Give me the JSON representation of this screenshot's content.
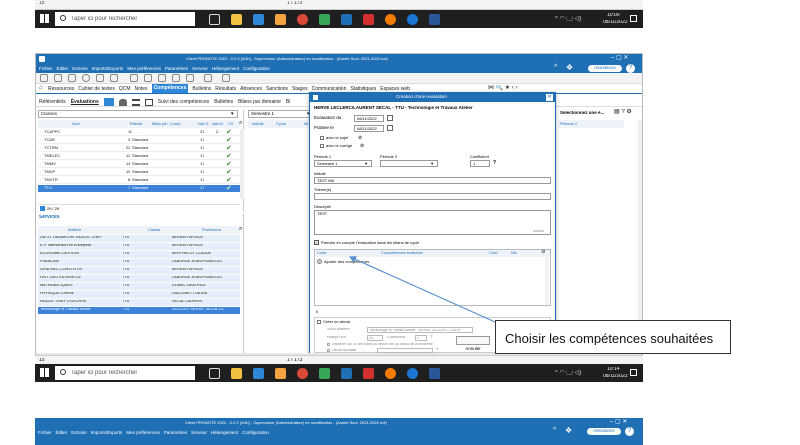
{
  "top_partial": {
    "pager": "15",
    "page_count": "1 / 173"
  },
  "taskbar": {
    "search_placeholder": "Taper ici pour rechercher",
    "tray": "^ ◠ 🗔 ◁)",
    "time1": "10:00",
    "date1": "08/11/2022",
    "time2": "10:14",
    "date2": "08/11/2022"
  },
  "app": {
    "title": "Client PRONOTE 2022 - 0.2.9 [4/4b] - Superviseur (Administrateur) en modification - (Année Scol. 2021-2022.not)",
    "menus": [
      "Fichier",
      "Éditer",
      "Extraire",
      "Imports/Exports",
      "Mes préférences",
      "Paramètres",
      "Serveur",
      "Hébergement",
      "Configuration"
    ],
    "assistance": "Assistance",
    "help": "?",
    "tabs": [
      "Ressources",
      "Cahier de textes",
      "QCM",
      "Notes",
      "Compétences",
      "Bulletins",
      "Résultats",
      "Absences",
      "Sanctions",
      "Stages",
      "Communication",
      "Statistiques",
      "Espaces web"
    ],
    "subtabs": [
      "Référentiels",
      "Évaluations",
      "Suivi des compétences",
      "Bulletins",
      "Bilans par domaine",
      "Bi"
    ],
    "classes_label": "Classes",
    "classes_cols": [
      "Nom",
      "Effectif",
      "Bilan pér. Comp.",
      "Nat.G.",
      "Nat.M.",
      "Cll"
    ],
    "classes_rows": [
      {
        "name": "TCAPPC",
        "eff": "10",
        "bilan": "-",
        "g": "23",
        "m": "2"
      },
      {
        "name": "TCAR",
        "eff": "3",
        "bilan": "Standard",
        "g": "17",
        "m": ""
      },
      {
        "name": "TCTRM",
        "eff": "22",
        "bilan": "Standard",
        "g": "17",
        "m": ""
      },
      {
        "name": "TMELEC",
        "eff": "12",
        "bilan": "Standard",
        "g": "17",
        "m": ""
      },
      {
        "name": "TMMV",
        "eff": "14",
        "bilan": "Standard",
        "g": "17",
        "m": ""
      },
      {
        "name": "TMVP",
        "eff": "15",
        "bilan": "Standard",
        "g": "17",
        "m": ""
      },
      {
        "name": "TMVTR",
        "eff": "8",
        "bilan": "Standard",
        "g": "17",
        "m": ""
      },
      {
        "name": "TTU",
        "eff": "7",
        "bilan": "Standard",
        "g": "17",
        "m": ""
      }
    ],
    "classes_pager": "29 / 29",
    "services_label": "Services",
    "services_cols": [
      "Matière",
      "Classe",
      "Professeur"
    ],
    "services_rows": [
      {
        "m": "DECO. DEMARCHE REALIS. CHEF",
        "c": "TTU",
        "p": "BEREIN PATRICK"
      },
      {
        "m": "E.P. Intervention en Entreprise",
        "c": "TTU",
        "p": "BEREIN PATRICK"
      },
      {
        "m": "ECONOMIE-GESTION",
        "c": "TTU",
        "p": "BERTHELOT CLAUDE"
      },
      {
        "m": "FRANCAIS",
        "c": "TTU",
        "p": "LABORDE JEAN-FRANCOIS"
      },
      {
        "m": "GENI.MEC.CONSTR.OV",
        "c": "TTU",
        "p": "BEREIN PATRICK"
      },
      {
        "m": "HIST-GEO EN MOR.OV",
        "c": "TTU",
        "p": "LABORDE JEAN-FRANCOIS"
      },
      {
        "m": "MATHEMATIQUES",
        "c": "TTU",
        "p": "DOMEC BEATRICE"
      },
      {
        "m": "PHYSIQUE-CHIMIE",
        "c": "TTU",
        "p": "GIACOMETTI ALAIN"
      },
      {
        "m": "REALIS. CHEF D'OEUVRE",
        "c": "TTU",
        "p": "SECAL LAURENT"
      },
      {
        "m": "Technologie et Travaux Atelier",
        "c": "TTU",
        "p": "LECLERC HERVE, SECAL LA"
      }
    ],
    "period": "Semestre 1",
    "middle_cols": [
      "Intitulé",
      "Cycle",
      "Mt"
    ],
    "right_label": "Sélectionnez une é...",
    "right_col": "Période 2"
  },
  "dialog": {
    "title": "Création d'une évaluation",
    "subject": "HERVE LECLERC/LAURENT SECAL - TTU - Technologie et Travaux Atelier",
    "eval_date_label": "Évaluation du",
    "eval_date": "08/11/2022",
    "publish_label": "Publiée le",
    "publish_date": "08/11/2022",
    "with_subject": "avec le sujet",
    "with_answer": "avec le corrigé",
    "period1_label": "Période 1",
    "period1_value": "Semestre 1",
    "period2_label": "Période 2",
    "coef_label": "Coefficient",
    "coef_value": "1",
    "intitule_label": "Intitulé",
    "intitule_value": "TEST M6",
    "theme_label": "Thème(s)",
    "desc_label": "Descriptif",
    "desc_value": "TEST",
    "desc_count": "4/1000",
    "take_into_account": "Prendre en compte l'évaluation dans les bilans de cycle",
    "comp_cols": [
      "Code",
      "Compétences évaluées",
      "Coef.",
      "Niv."
    ],
    "add_comp": "Ajouter des compétences",
    "count0": "0",
    "create_devoir": "Créer un devoir",
    "sous_matiere_label": "Sous-matière",
    "sous_matiere_value": "Technologie et Travaux Atelier - HERVE LECLERC / LAUR",
    "note_sur_label": "Noté(e) sur",
    "note_sur_value": "20",
    "coefficient_label": "Coefficient",
    "coefficient_value": "1",
    "ramener_label": "Ramener sur 20 les notes du devoir lors du calcul de la moyenne",
    "facultatif_label": "Devoir facultatif",
    "cancel": "Annuler"
  },
  "annotation": {
    "text": "Choisir les compétences souhaitées"
  },
  "bottom_partial": {
    "title": "Client PRONOTE 2022 - 0.2.9 [4/4b] - Superviseur (Administrateur) en modification - (Année Scol. 2021-2022.not)",
    "menus": [
      "Fichier",
      "Éditer",
      "Extraire",
      "Imports/Exports",
      "Mes préférences",
      "Paramètres",
      "Serveur",
      "Hébergement",
      "Configuration"
    ],
    "assistance": "Assistance"
  },
  "colors": {
    "app_blue": "#1f6fb5",
    "tab_active": "#2f87d8",
    "selection": "#3b82d8",
    "taskbar": "#1f1f1f",
    "annotation_arrow": "#5b8fd1"
  }
}
